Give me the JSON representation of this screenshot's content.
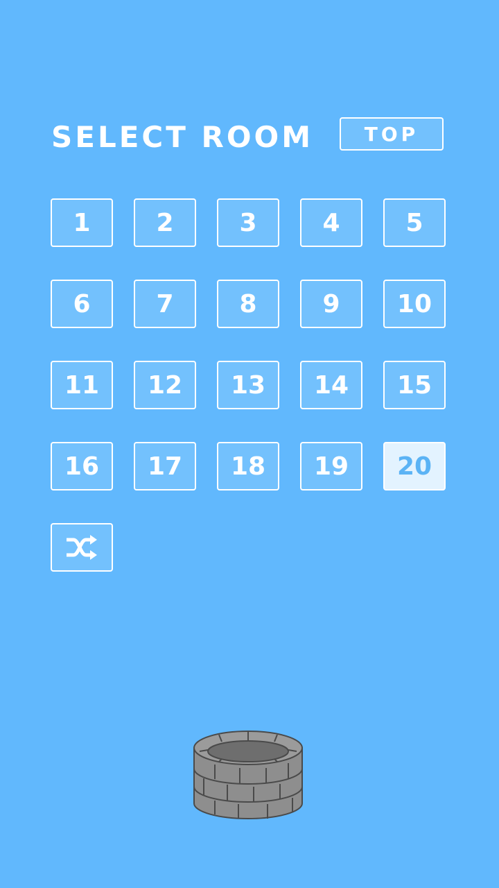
{
  "header": {
    "title": "SELECT ROOM",
    "top_label": "TOP"
  },
  "rooms": [
    {
      "label": "1"
    },
    {
      "label": "2"
    },
    {
      "label": "3"
    },
    {
      "label": "4"
    },
    {
      "label": "5"
    },
    {
      "label": "6"
    },
    {
      "label": "7"
    },
    {
      "label": "8"
    },
    {
      "label": "9"
    },
    {
      "label": "10"
    },
    {
      "label": "11"
    },
    {
      "label": "12"
    },
    {
      "label": "13"
    },
    {
      "label": "14"
    },
    {
      "label": "15"
    },
    {
      "label": "16"
    },
    {
      "label": "17"
    },
    {
      "label": "18"
    },
    {
      "label": "19"
    },
    {
      "label": "20",
      "selected": true
    }
  ],
  "shuffle_icon": "shuffle-icon",
  "decoration_icon": "stone-well-icon",
  "colors": {
    "background": "#61b8fd",
    "button_fill": "#73c1fd",
    "selected_fill": "#e3f3ff",
    "selected_text": "#5bb3f5"
  }
}
